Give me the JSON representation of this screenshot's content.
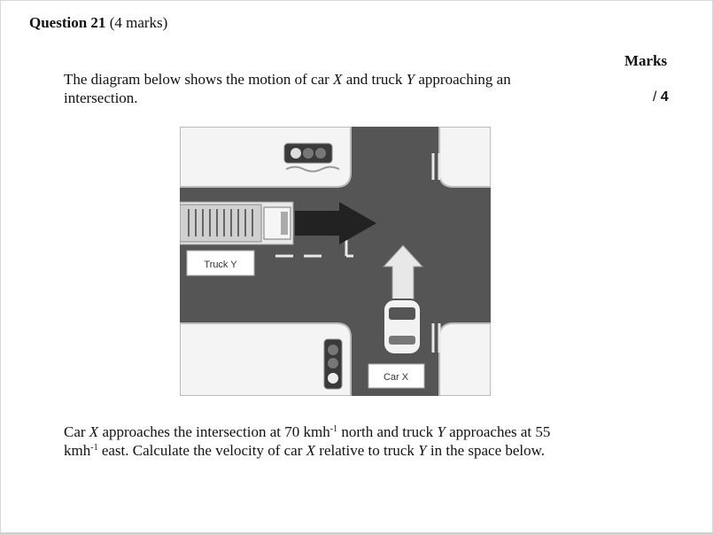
{
  "question": {
    "title": "Question 21",
    "marks_paren": "(4 marks)"
  },
  "marks_column": {
    "heading": "Marks",
    "slash": "/",
    "total": "4"
  },
  "intro": {
    "part1": "The diagram below shows the motion of car ",
    "car": "X",
    "part2": " and truck ",
    "truck": "Y",
    "part3": " approaching an intersection."
  },
  "diagram": {
    "truck_label": "Truck Y",
    "car_label": "Car X"
  },
  "body": {
    "t1": "Car ",
    "car": "X",
    "t2": " approaches the intersection at 70 kmh",
    "sup1": "-1",
    "t3": " north and truck ",
    "truck": "Y",
    "t4": " approaches at 55 kmh",
    "sup2": "-1",
    "t5": " east.  Calculate the velocity of car ",
    "car2": "X",
    "t6": " relative to truck ",
    "truck2": "Y",
    "t7": " in the space below."
  }
}
